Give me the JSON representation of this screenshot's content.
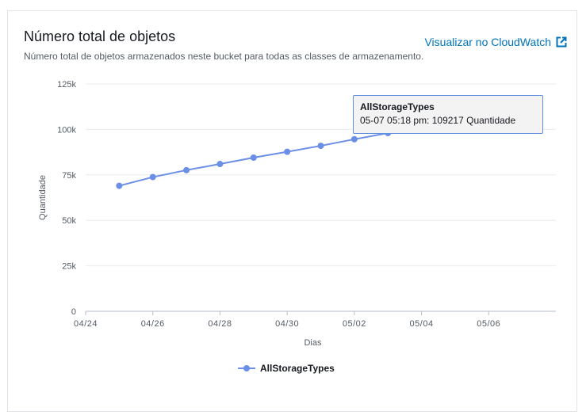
{
  "panel": {
    "title": "Número total de objetos",
    "subtitle": "Número total de objetos armazenados neste bucket para todas as classes de armazenamento.",
    "link_label": "Visualizar no CloudWatch",
    "link_icon": "external-link-icon"
  },
  "tooltip": {
    "series": "AllStorageTypes",
    "text": "05-07 05:18 pm: 109217 Quantidade"
  },
  "legend": {
    "label": "AllStorageTypes"
  },
  "colors": {
    "series": "#6b8ee6",
    "link": "#0073bb",
    "grid": "#e9ebed"
  },
  "chart_data": {
    "type": "line",
    "title": "Número total de objetos",
    "xlabel": "Dias",
    "ylabel": "Quantidade",
    "x_ticks": [
      "04/24",
      "04/26",
      "04/28",
      "04/30",
      "05/02",
      "05/04",
      "05/06"
    ],
    "y_ticks": [
      "0",
      "25k",
      "50k",
      "75k",
      "100k",
      "125k"
    ],
    "ylim": [
      0,
      125000
    ],
    "xlim": [
      "04/24",
      "05/08"
    ],
    "grid": true,
    "legend_position": "bottom",
    "series": [
      {
        "name": "AllStorageTypes",
        "x": [
          "04/25",
          "04/26",
          "04/27",
          "04/28",
          "04/29",
          "04/30",
          "05/01",
          "05/02",
          "05/03",
          "05/04",
          "05/05",
          "05/07"
        ],
        "values": [
          69000,
          73800,
          77600,
          81000,
          84500,
          87700,
          91000,
          94600,
          98000,
          101200,
          104500,
          109217
        ]
      }
    ]
  }
}
